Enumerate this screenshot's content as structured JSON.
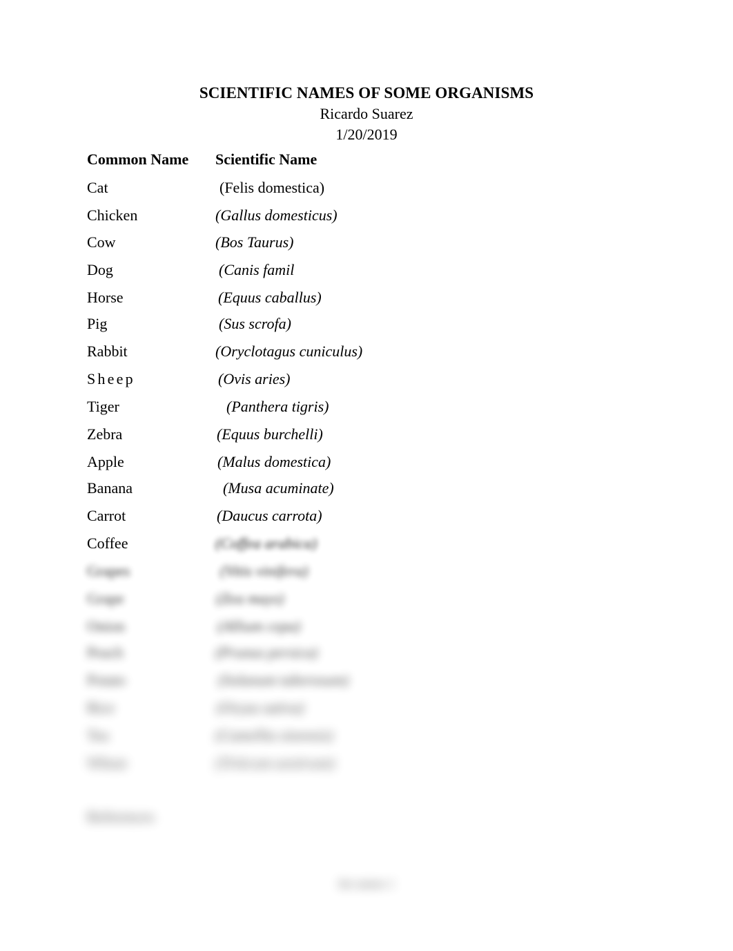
{
  "document": {
    "title": "SCIENTIFIC NAMES OF SOME ORGANISMS",
    "author": "Ricardo Suarez",
    "date": "1/20/2019"
  },
  "table": {
    "headers": {
      "common": "Common Name",
      "scientific": "Scientific Name"
    },
    "rows": [
      {
        "common": "Cat",
        "scientific": "(Felis domestica)"
      },
      {
        "common": "Chicken",
        "scientific": "(Gallus domesticus)"
      },
      {
        "common": "Cow",
        "scientific": "(Bos Taurus)"
      },
      {
        "common": "Dog",
        "scientific": "(Canis famil"
      },
      {
        "common": "Horse",
        "scientific": "(Equus caballus)"
      },
      {
        "common": "Pig",
        "scientific": "(Sus scrofa)"
      },
      {
        "common": "Rabbit",
        "scientific": "(Oryclotagus cuniculus)"
      },
      {
        "common": "Sheep",
        "scientific": "(Ovis aries)"
      },
      {
        "common": "Tiger",
        "scientific": "(Panthera tigris)"
      },
      {
        "common": "Zebra",
        "scientific": "(Equus burchelli)"
      },
      {
        "common": "Apple",
        "scientific": "(Malus domestica)"
      },
      {
        "common": "Banana",
        "scientific": "(Musa acuminate)"
      },
      {
        "common": "Carrot",
        "scientific": "(Daucus carrota)"
      },
      {
        "common": "Coffee",
        "scientific": "(Coffea arabica)"
      },
      {
        "common": "Grapes",
        "scientific": "(Vitis vinifera)"
      },
      {
        "common": "Grape",
        "scientific": "(Zea mays)"
      },
      {
        "common": "Onion",
        "scientific": "(Allium cepa)"
      },
      {
        "common": "Peach",
        "scientific": "(Prunus persica)"
      },
      {
        "common": "Potato",
        "scientific": "(Solanum tuberosum)"
      },
      {
        "common": "Rice",
        "scientific": "(Oryza sativa)"
      },
      {
        "common": "Tea",
        "scientific": "(Camellia sinensis)"
      },
      {
        "common": "Wheat",
        "scientific": "(Triticum aestivum)"
      }
    ]
  },
  "references": {
    "heading": "References"
  },
  "footer": {
    "text": "the names 1"
  }
}
